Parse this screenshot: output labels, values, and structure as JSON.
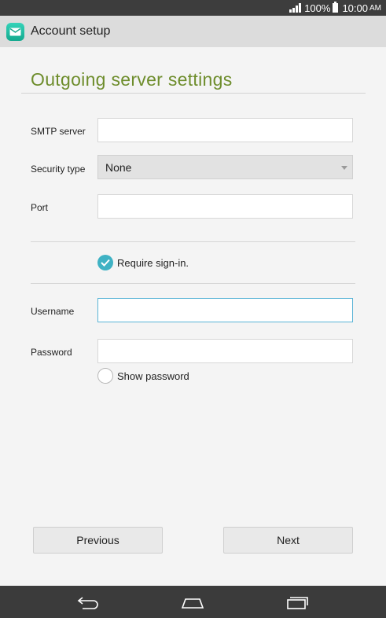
{
  "status_bar": {
    "battery_percent": "100%",
    "time": "10:00",
    "ampm": "AM",
    "text_color": "#ffffff",
    "background": "#3d3d3d"
  },
  "action_bar": {
    "title": "Account setup",
    "app_icon": "email-envelope-icon",
    "accent": "#1fbf9f"
  },
  "page": {
    "title": "Outgoing server settings",
    "title_color": "#6e8d2c"
  },
  "form": {
    "smtp_server": {
      "label": "SMTP server",
      "value": "",
      "placeholder": ""
    },
    "security_type": {
      "label": "Security type",
      "value": "None"
    },
    "port": {
      "label": "Port",
      "value": "",
      "placeholder": ""
    },
    "require_signin": {
      "label": "Require sign-in.",
      "checked": true,
      "color": "#3fb2c4"
    },
    "username": {
      "label": "Username",
      "value": "",
      "placeholder": "",
      "focused": true
    },
    "password": {
      "label": "Password",
      "value": "",
      "placeholder": ""
    },
    "show_password": {
      "label": "Show password",
      "checked": false
    }
  },
  "buttons": {
    "previous": "Previous",
    "next": "Next"
  },
  "nav_bar": {
    "back_icon": "back-icon",
    "home_icon": "home-icon",
    "recents_icon": "recent-apps-icon"
  }
}
